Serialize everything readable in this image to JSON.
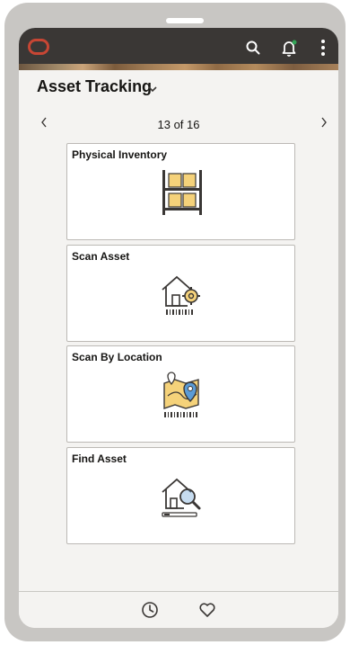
{
  "header": {
    "title": "Asset Tracking"
  },
  "pager": {
    "text": "13 of 16",
    "prev_icon": "chevron-left-icon",
    "next_icon": "chevron-right-icon"
  },
  "tiles": [
    {
      "title": "Physical Inventory",
      "icon": "inventory-shelf-icon"
    },
    {
      "title": "Scan Asset",
      "icon": "house-gear-barcode-icon"
    },
    {
      "title": "Scan By Location",
      "icon": "map-pin-barcode-icon"
    },
    {
      "title": "Find Asset",
      "icon": "house-magnifier-icon"
    }
  ],
  "topbar": {
    "icons": [
      "oracle-logo",
      "search-icon",
      "bell-icon",
      "more-vertical-icon"
    ]
  },
  "bottombar": {
    "icons": [
      "recent-clock-icon",
      "favorites-heart-icon"
    ]
  },
  "colors": {
    "brand": "#c74634",
    "topbar": "#3a3735",
    "tile_icon_fill": "#f5d27a",
    "tile_icon_accent": "#5b9bd5",
    "notification_dot": "#33a357"
  }
}
